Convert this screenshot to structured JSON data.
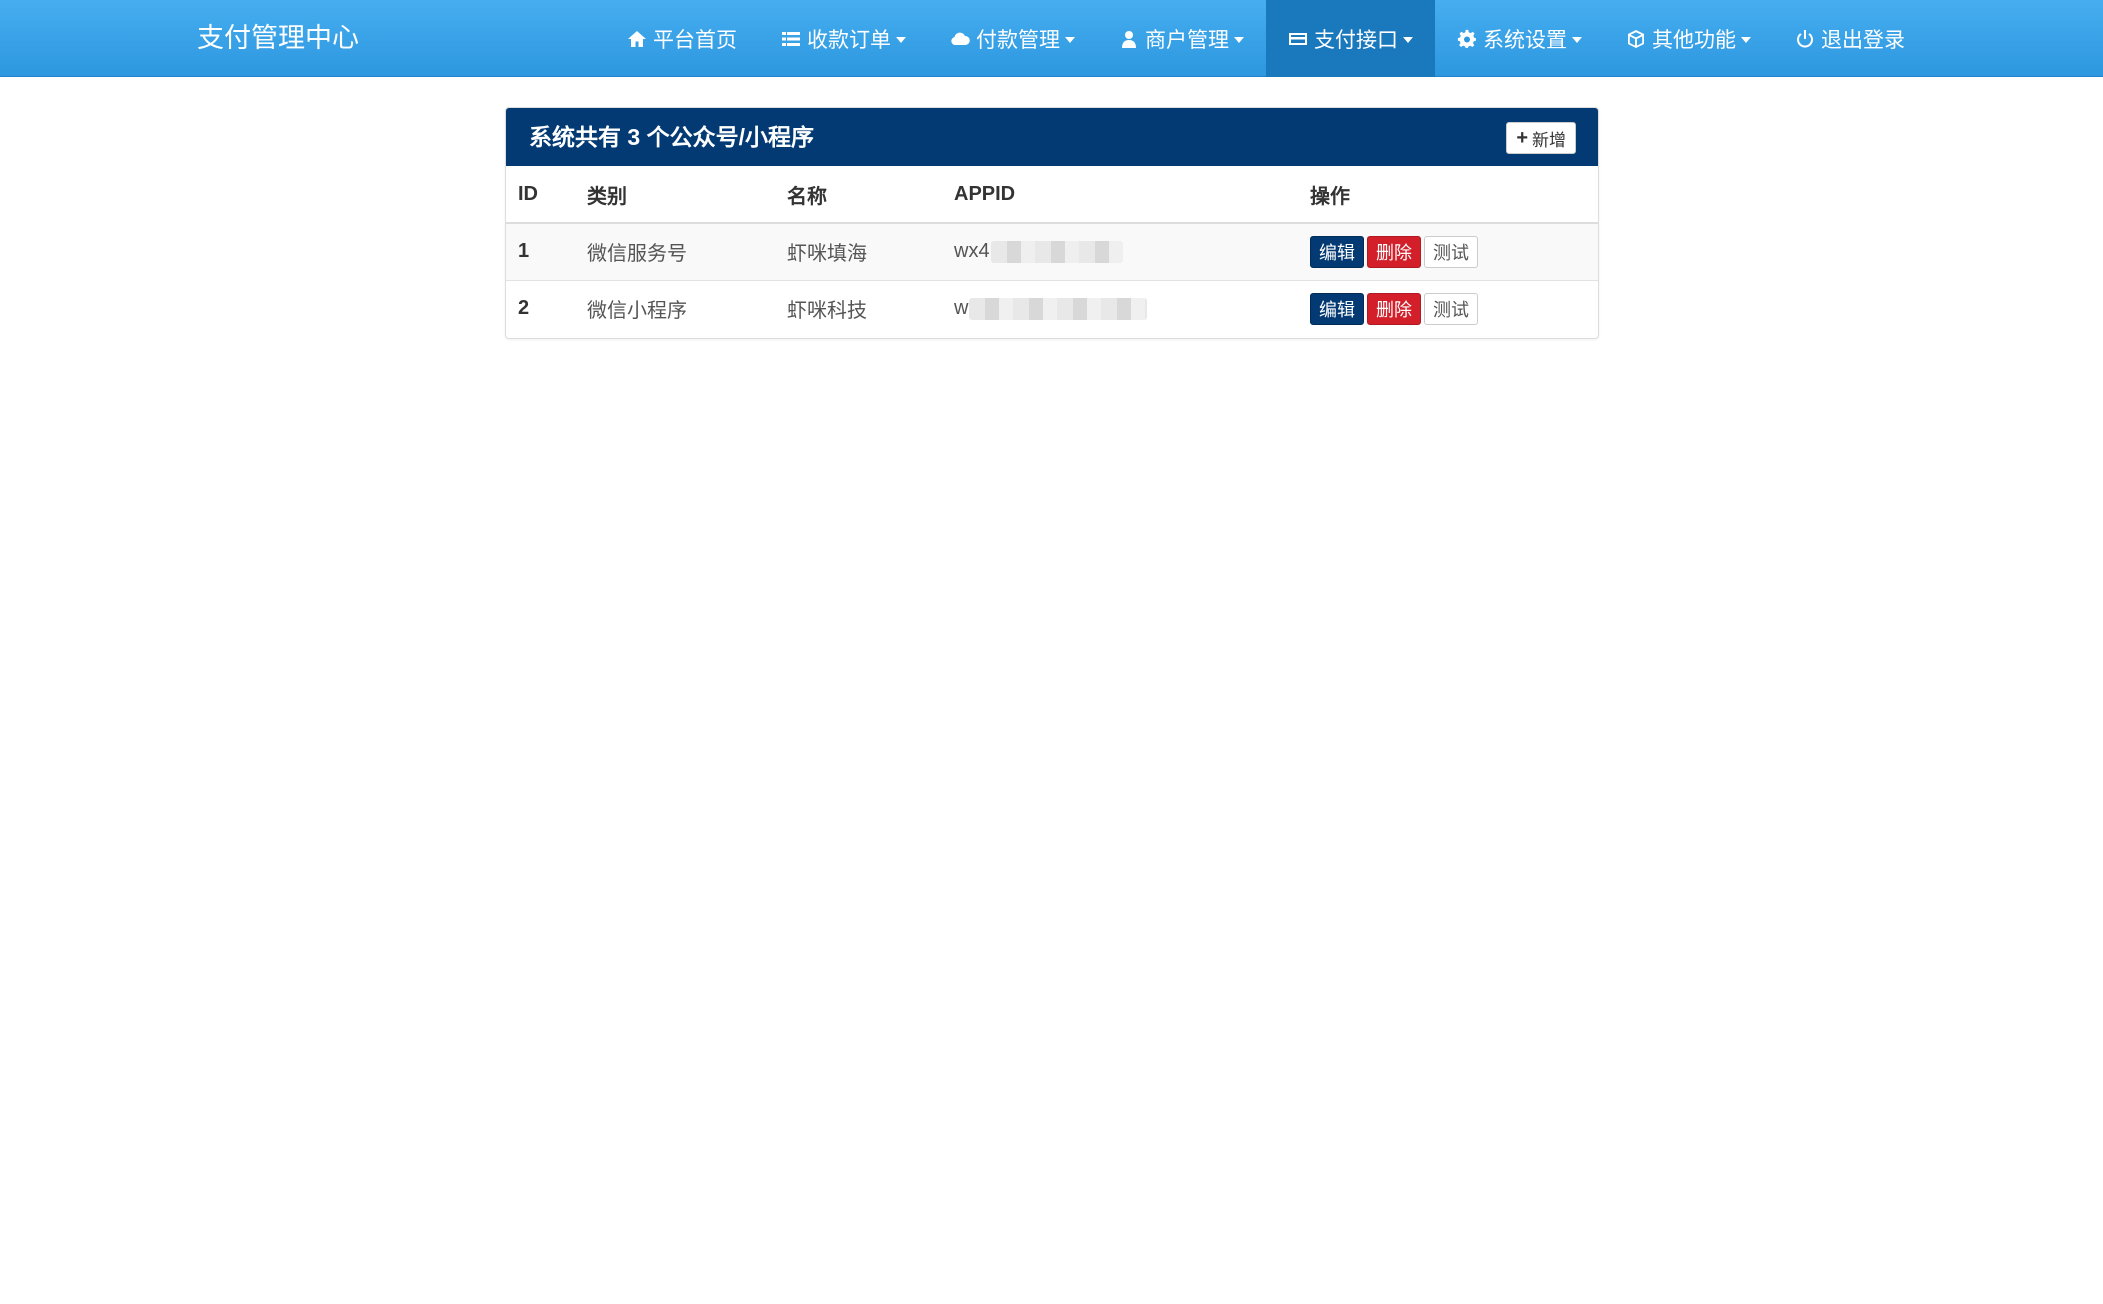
{
  "navbar": {
    "brand": "支付管理中心",
    "items": [
      {
        "label": "平台首页",
        "icon": "home-icon",
        "caret": false,
        "active": false
      },
      {
        "label": "收款订单",
        "icon": "list-icon",
        "caret": true,
        "active": false
      },
      {
        "label": "付款管理",
        "icon": "cloud-icon",
        "caret": true,
        "active": false
      },
      {
        "label": "商户管理",
        "icon": "user-icon",
        "caret": true,
        "active": false
      },
      {
        "label": "支付接口",
        "icon": "credit-card-icon",
        "caret": true,
        "active": true
      },
      {
        "label": "系统设置",
        "icon": "gear-icon",
        "caret": true,
        "active": false
      },
      {
        "label": "其他功能",
        "icon": "cube-icon",
        "caret": true,
        "active": false
      },
      {
        "label": "退出登录",
        "icon": "power-icon",
        "caret": false,
        "active": false
      }
    ]
  },
  "panel": {
    "title": "系统共有 3 个公众号/小程序",
    "add_label": "新增",
    "columns": [
      "ID",
      "类别",
      "名称",
      "APPID",
      "操作"
    ],
    "rows": [
      {
        "id": "1",
        "type": "微信服务号",
        "name": "虾咪填海",
        "appid_visible": "wx4",
        "appid_blurred": true
      },
      {
        "id": "2",
        "type": "微信小程序",
        "name": "虾咪科技",
        "appid_visible": "w",
        "appid_blurred": true
      }
    ],
    "actions": {
      "edit": "编辑",
      "delete": "删除",
      "test": "测试"
    }
  },
  "colors": {
    "navbar_top": "#46aef0",
    "navbar_bottom": "#2d97df",
    "nav_active": "#1a78bd",
    "panel_heading": "#033a73",
    "edit_button": "#033a73",
    "delete_button": "#d21f2a"
  }
}
